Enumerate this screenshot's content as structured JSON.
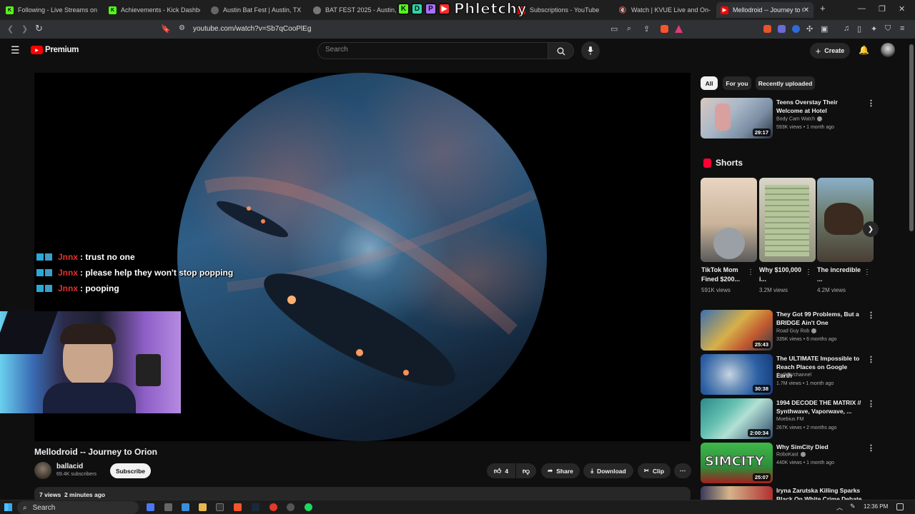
{
  "browser": {
    "tabs": [
      {
        "title": "Following - Live Streams on Ki",
        "icon": "kick-icon",
        "color": "#53fc18"
      },
      {
        "title": "Achievements - Kick Dashboar",
        "icon": "kick-icon",
        "color": "#53fc18"
      },
      {
        "title": "Austin Bat Fest | Austin, TX",
        "icon": "globe-icon",
        "color": "#888888"
      },
      {
        "title": "BAT FEST 2025 - Austin, Texa",
        "icon": "globe-icon",
        "color": "#888888"
      },
      {
        "title": "Subscriptions - YouTube",
        "icon": "youtube-icon",
        "color": "#ff0000"
      },
      {
        "title": "Watch | KVUE Live and On-",
        "icon": "mute-icon",
        "color": "#cccccc"
      },
      {
        "title": "Mellodroid -- Journey to O",
        "icon": "youtube-icon",
        "color": "#ff0000",
        "active": true
      }
    ],
    "url": "youtube.com/watch?v=Sb7qCooPlEg",
    "close_glyph": "✕",
    "new_tab_glyph": "+"
  },
  "overlay_logo": {
    "badges": [
      "K",
      "D",
      "P",
      "▶"
    ],
    "text": "Phletchy"
  },
  "header": {
    "premium_label": "Premium",
    "search_placeholder": "Search",
    "create_label": "Create"
  },
  "chat": [
    {
      "user": "Jnnx",
      "message": ": trust no one"
    },
    {
      "user": "Jnnx",
      "message": ": please help they won't stop popping"
    },
    {
      "user": "Jnnx",
      "message": ": pooping"
    }
  ],
  "video": {
    "title": "Mellodroid -- Journey to Orion",
    "channel": "ballacid",
    "subscribers": "69.4K subscribers",
    "subscribe_label": "Subscribe",
    "likes": "4",
    "share_label": "Share",
    "download_label": "Download",
    "clip_label": "Clip",
    "views_age": "7 views  2 minutes ago"
  },
  "chips": [
    "All",
    "For you",
    "Recently uploaded"
  ],
  "recommendations_top": [
    {
      "title": "Teens Overstay Their Welcome at Hotel",
      "channel": "Body Cam Watch",
      "verified": true,
      "meta": "593K views • 1 month ago",
      "duration": "29:17"
    }
  ],
  "shorts": {
    "heading": "Shorts",
    "items": [
      {
        "title": "TikTok Mom Fined $200...",
        "views": "591K views"
      },
      {
        "title": "Why $100,000 i...",
        "views": "3.2M views"
      },
      {
        "title": "The incredible ...",
        "views": "4.2M views"
      }
    ]
  },
  "recommendations": [
    {
      "title": "They Got 99 Problems, But a BRIDGE Ain't One",
      "channel": "Road Guy Rob",
      "verified": true,
      "meta": "335K views • 6 months ago",
      "duration": "25:43"
    },
    {
      "title": "The ULTIMATE Impossible to Reach Places on Google Earth",
      "channel": "thePOVchannel",
      "verified": false,
      "meta": "1.7M views • 1 month ago",
      "duration": "30:38"
    },
    {
      "title": "1994 DECODE THE MATRIX // Synthwave, Vaporwave, ...",
      "channel": "Moebius FM",
      "verified": false,
      "meta": "267K views • 2 months ago",
      "duration": "2:00:34"
    },
    {
      "title": "Why SimCity Died",
      "channel": "RoboKast",
      "verified": true,
      "meta": "440K views • 1 month ago",
      "duration": "25:07"
    },
    {
      "title": "Iryna Zarutska Killing Sparks Black On White Crime Debate f...",
      "channel": "",
      "verified": false,
      "meta": "",
      "duration": ""
    }
  ],
  "taskbar": {
    "search_placeholder": "Search",
    "time": "12:36 PM"
  }
}
